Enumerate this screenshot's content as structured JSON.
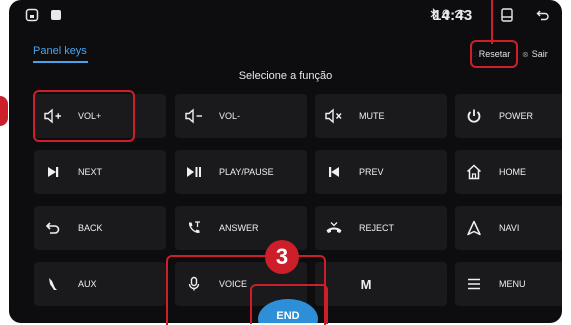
{
  "statusbar": {
    "clock": "14:43",
    "indicators": [
      "bluetooth-icon",
      "location-icon",
      "wifi-icon"
    ]
  },
  "tabs": {
    "active": "Panel keys"
  },
  "header": {
    "reset_label": "Resetar",
    "exit_label": "Sair",
    "subtitle": "Selecione a função"
  },
  "keys": [
    {
      "label": "VOL+",
      "icon": "volume-up-icon"
    },
    {
      "label": "VOL-",
      "icon": "volume-down-icon"
    },
    {
      "label": "MUTE",
      "icon": "mute-icon"
    },
    {
      "label": "POWER",
      "icon": "power-icon"
    },
    {
      "label": "NEXT",
      "icon": "next-track-icon"
    },
    {
      "label": "PLAY/PAUSE",
      "icon": "play-pause-icon"
    },
    {
      "label": "PREV",
      "icon": "previous-track-icon"
    },
    {
      "label": "HOME",
      "icon": "home-icon"
    },
    {
      "label": "BACK",
      "icon": "back-arrow-icon"
    },
    {
      "label": "ANSWER",
      "icon": "answer-call-icon"
    },
    {
      "label": "REJECT",
      "icon": "reject-call-icon"
    },
    {
      "label": "NAVI",
      "icon": "navigation-icon"
    },
    {
      "label": "AUX",
      "icon": "aux-cable-icon"
    },
    {
      "label": "VOICE",
      "icon": "microphone-icon"
    },
    {
      "label": "",
      "icon": "mode-m-icon",
      "glyph": "M"
    },
    {
      "label": "MENU",
      "icon": "menu-icon"
    }
  ],
  "end_button": {
    "label": "END"
  },
  "annotation": {
    "step": "3"
  },
  "colors": {
    "accent": "#4aa3e8",
    "highlight": "#cc1f2a",
    "key_bg": "#1a1a1d",
    "screen_bg": "#0d0d0f",
    "end_button": "#2d8fd8"
  }
}
